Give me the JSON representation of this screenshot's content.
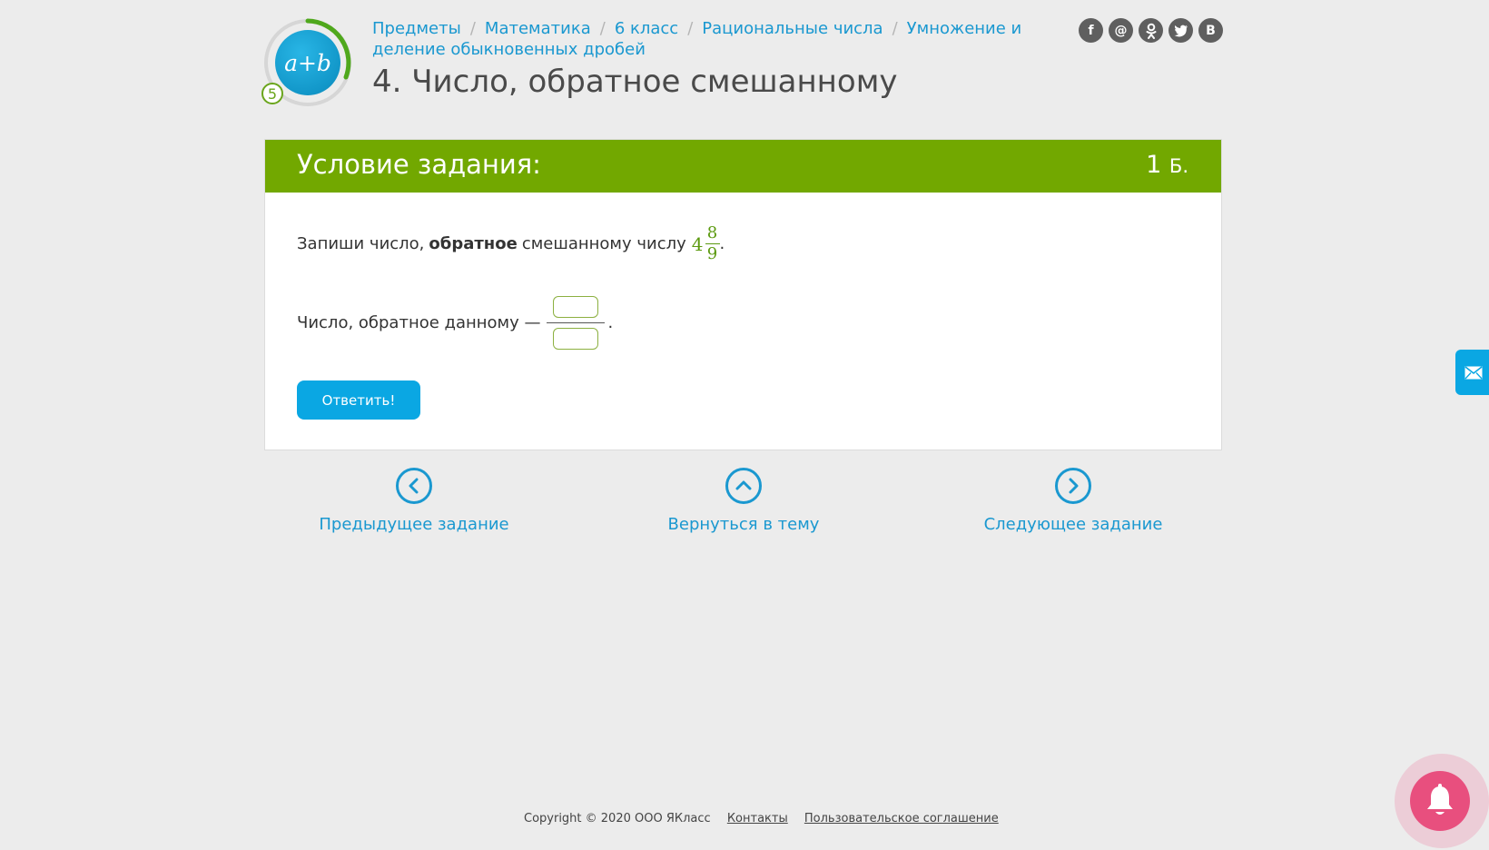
{
  "header": {
    "logo_text": "a+b",
    "grade": "5",
    "breadcrumb": [
      "Предметы",
      "Математика",
      "6 класс",
      "Рациональные числа",
      "Умножение и деление обыкновенных дробей"
    ],
    "breadcrumb_sep": "/",
    "title": "4. Число, обратное смешанному",
    "social": [
      "f",
      "@",
      "ok",
      "tw",
      "B"
    ]
  },
  "task": {
    "heading": "Условие задания:",
    "points_value": "1",
    "points_unit": "Б.",
    "text_before": "Запиши число,",
    "text_bold": "обратное",
    "text_after": "смешанному числу",
    "mixed_whole": "4",
    "mixed_num": "8",
    "mixed_den": "9",
    "period": ".",
    "answer_label": "Число, обратное данному —",
    "answer_numerator": "",
    "answer_denominator": "",
    "submit_label": "Ответить!"
  },
  "nav": {
    "prev_label": "Предыдущее задание",
    "back_label": "Вернуться в тему",
    "next_label": "Следующее задание"
  },
  "footer": {
    "copyright": "Copyright © 2020 ООО ЯКласс",
    "contacts": "Контакты",
    "agreement": "Пользовательское соглашение"
  },
  "colors": {
    "accent_green": "#72a800",
    "link_blue": "#1a98d0",
    "button_blue": "#0aa7e3",
    "bell_pink": "#e84f7e"
  }
}
